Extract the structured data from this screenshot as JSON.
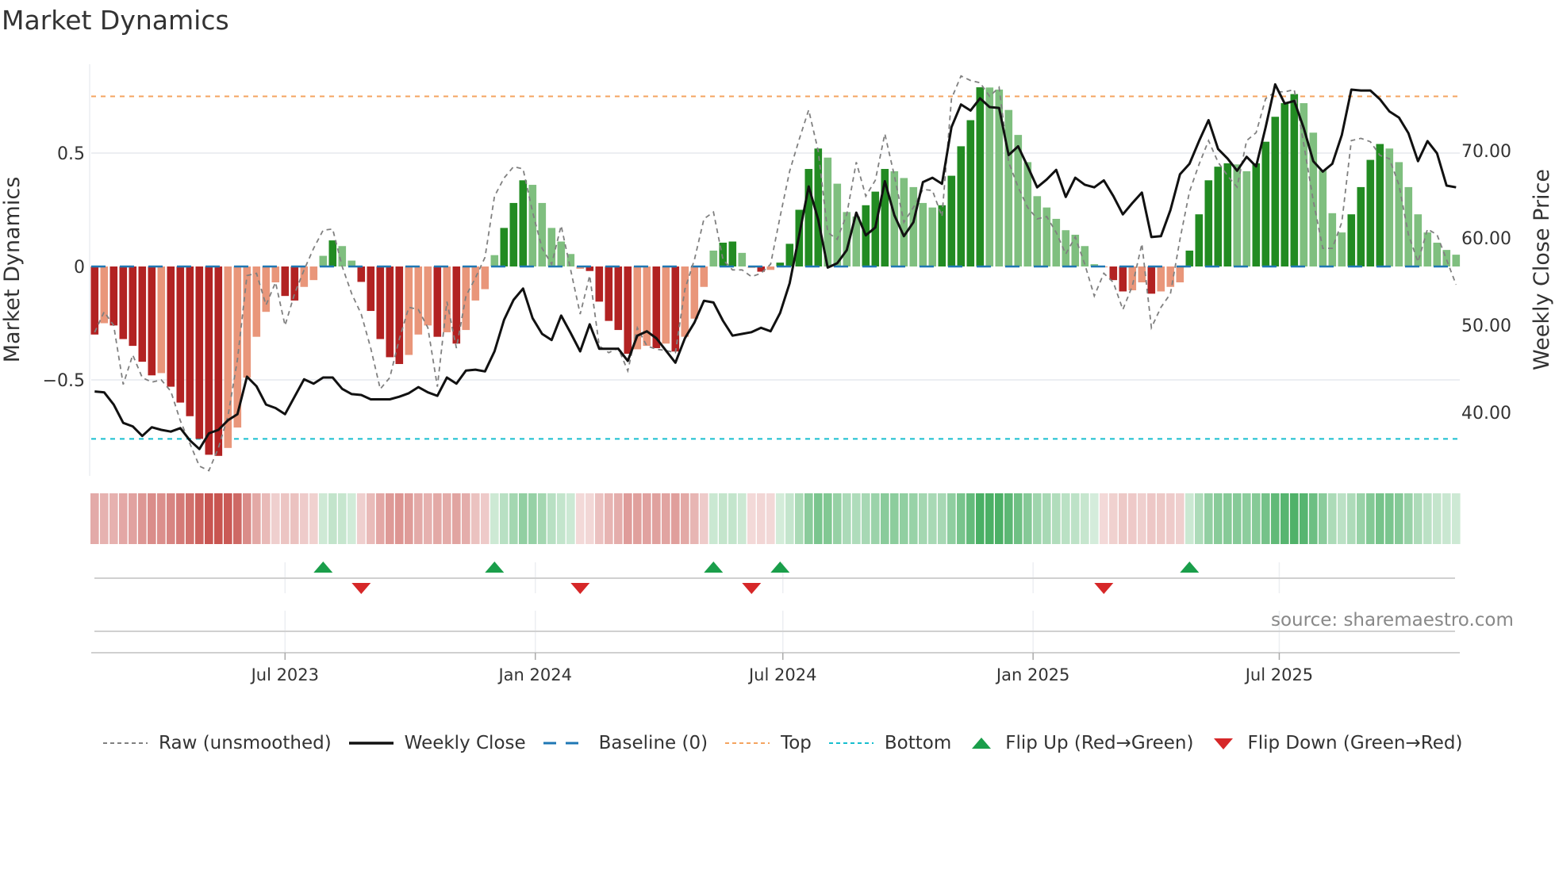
{
  "title": "Market Dynamics",
  "source": "source: sharemaestro.com",
  "colors": {
    "dark_red": "#b22222",
    "light_red": "#e9967a",
    "dark_green": "#228b22",
    "light_green": "#7fbf7f",
    "baseline": "#1f77b4",
    "top": "#f4a460",
    "bottom": "#17becf",
    "close": "#111111",
    "raw": "#808080",
    "flip_up": "#1a9e4a",
    "flip_down": "#d62728"
  },
  "legend": [
    {
      "key": "raw",
      "label": "Raw (unsmoothed)"
    },
    {
      "key": "close",
      "label": "Weekly Close"
    },
    {
      "key": "baseline",
      "label": "Baseline (0)"
    },
    {
      "key": "top",
      "label": "Top"
    },
    {
      "key": "bottom",
      "label": "Bottom"
    },
    {
      "key": "flip_up",
      "label": "Flip Up (Red→Green)"
    },
    {
      "key": "flip_down",
      "label": "Flip Down (Green→Red)"
    }
  ],
  "chart_data": {
    "type": "bar",
    "title": "Market Dynamics",
    "ylabel": "Market Dynamics",
    "y2label": "Weekly Close Price",
    "ylim": [
      -0.92,
      0.89
    ],
    "y2lim": [
      36.5,
      80.7
    ],
    "yticks": [
      {
        "v": 0.5,
        "label": "0.5"
      },
      {
        "v": 0,
        "label": "0"
      },
      {
        "v": -0.5,
        "label": "−0.5"
      }
    ],
    "y2ticks": [
      {
        "v": 70,
        "label": "70.00"
      },
      {
        "v": 60,
        "label": "60.00"
      },
      {
        "v": 50,
        "label": "50.00"
      },
      {
        "v": 40,
        "label": "40.00"
      }
    ],
    "start_date": "2023-02-11",
    "frequency": "weekly",
    "xticks": [
      {
        "date": "2023-07-01",
        "label": "Jul 2023"
      },
      {
        "date": "2024-01-01",
        "label": "Jan 2024"
      },
      {
        "date": "2024-07-01",
        "label": "Jul 2024"
      },
      {
        "date": "2025-01-01",
        "label": "Jan 2025"
      },
      {
        "date": "2025-07-01",
        "label": "Jul 2025"
      }
    ],
    "top": 0.75,
    "bottom": -0.76,
    "baseline": 0,
    "grid": true,
    "legend_position": "bottom",
    "hist": [
      -0.3,
      -0.25,
      -0.26,
      -0.32,
      -0.35,
      -0.42,
      -0.48,
      -0.47,
      -0.53,
      -0.6,
      -0.66,
      -0.76,
      -0.83,
      -0.835,
      -0.8,
      -0.71,
      -0.49,
      -0.31,
      -0.2,
      -0.07,
      -0.13,
      -0.15,
      -0.09,
      -0.06,
      0.047,
      0.115,
      0.09,
      0.026,
      -0.068,
      -0.196,
      -0.32,
      -0.4,
      -0.43,
      -0.39,
      -0.3,
      -0.26,
      -0.31,
      -0.29,
      -0.34,
      -0.28,
      -0.15,
      -0.1,
      0.05,
      0.17,
      0.28,
      0.38,
      0.36,
      0.28,
      0.17,
      0.11,
      0.055,
      -0.01,
      -0.02,
      -0.155,
      -0.24,
      -0.28,
      -0.385,
      -0.365,
      -0.35,
      -0.36,
      -0.34,
      -0.375,
      -0.31,
      -0.23,
      -0.09,
      0.07,
      0.105,
      0.11,
      0.06,
      -0.006,
      -0.023,
      -0.015,
      0.017,
      0.1,
      0.25,
      0.43,
      0.52,
      0.48,
      0.365,
      0.24,
      0.22,
      0.27,
      0.33,
      0.43,
      0.42,
      0.39,
      0.35,
      0.28,
      0.26,
      0.27,
      0.4,
      0.53,
      0.645,
      0.79,
      0.789,
      0.78,
      0.69,
      0.58,
      0.46,
      0.31,
      0.26,
      0.21,
      0.16,
      0.14,
      0.09,
      0.01,
      -0.003,
      -0.06,
      -0.11,
      -0.105,
      -0.07,
      -0.12,
      -0.11,
      -0.09,
      -0.07,
      0.07,
      0.23,
      0.38,
      0.44,
      0.455,
      0.45,
      0.42,
      0.455,
      0.55,
      0.66,
      0.72,
      0.76,
      0.72,
      0.59,
      0.425,
      0.235,
      0.15,
      0.23,
      0.35,
      0.47,
      0.54,
      0.52,
      0.46,
      0.35,
      0.23,
      0.15,
      0.105,
      0.073,
      0.052
    ],
    "raw": [
      -0.29,
      -0.2,
      -0.26,
      -0.52,
      -0.39,
      -0.49,
      -0.51,
      -0.5,
      -0.55,
      -0.68,
      -0.78,
      -0.88,
      -0.9,
      -0.8,
      -0.66,
      -0.41,
      -0.04,
      -0.03,
      -0.17,
      -0.07,
      -0.26,
      -0.12,
      -0.015,
      0.08,
      0.16,
      0.165,
      0.0,
      -0.12,
      -0.21,
      -0.36,
      -0.54,
      -0.49,
      -0.32,
      -0.18,
      -0.19,
      -0.27,
      -0.53,
      -0.155,
      -0.36,
      -0.13,
      -0.05,
      0.04,
      0.31,
      0.39,
      0.44,
      0.43,
      0.24,
      0.08,
      0.01,
      0.18,
      -0.015,
      -0.21,
      -0.04,
      -0.35,
      -0.38,
      -0.36,
      -0.46,
      -0.27,
      -0.35,
      -0.365,
      -0.37,
      -0.38,
      -0.1,
      0.03,
      0.21,
      0.24,
      0.03,
      -0.015,
      -0.015,
      -0.045,
      -0.03,
      0.01,
      0.22,
      0.42,
      0.56,
      0.69,
      0.51,
      0.15,
      0.12,
      0.23,
      0.46,
      0.31,
      0.38,
      0.585,
      0.4,
      0.195,
      0.26,
      0.34,
      0.335,
      0.22,
      0.74,
      0.84,
      0.82,
      0.81,
      0.75,
      0.79,
      0.46,
      0.35,
      0.26,
      0.21,
      0.22,
      0.15,
      0.055,
      0.13,
      0.01,
      -0.13,
      -0.03,
      -0.07,
      -0.19,
      -0.085,
      0.1,
      -0.27,
      -0.18,
      -0.12,
      0.12,
      0.33,
      0.45,
      0.555,
      0.46,
      0.4,
      0.35,
      0.555,
      0.59,
      0.74,
      0.77,
      0.77,
      0.78,
      0.54,
      0.29,
      0.08,
      0.08,
      0.195,
      0.555,
      0.565,
      0.55,
      0.49,
      0.475,
      0.36,
      0.14,
      0.02,
      0.165,
      0.14,
      0.03,
      -0.08
    ],
    "close": [
      42.4,
      42.3,
      40.9,
      38.8,
      38.4,
      37.3,
      38.3,
      38.0,
      37.8,
      38.2,
      36.8,
      35.8,
      37.6,
      38.0,
      39.1,
      39.8,
      44.1,
      43.0,
      40.9,
      40.5,
      39.8,
      41.8,
      43.8,
      43.3,
      44.0,
      44.0,
      42.7,
      42.1,
      42.0,
      41.5,
      41.5,
      41.5,
      41.8,
      42.2,
      42.9,
      42.3,
      41.9,
      44.0,
      43.3,
      44.8,
      44.9,
      44.7,
      47.0,
      50.6,
      52.9,
      54.2,
      50.8,
      49.0,
      48.3,
      51.1,
      49.1,
      47.0,
      50.1,
      47.3,
      47.3,
      47.3,
      45.9,
      48.8,
      49.3,
      48.5,
      47.1,
      45.7,
      48.5,
      50.3,
      52.8,
      52.6,
      50.5,
      48.8,
      49.0,
      49.2,
      49.7,
      49.3,
      51.4,
      54.8,
      60.3,
      65.9,
      62.1,
      56.6,
      57.1,
      58.6,
      62.9,
      60.3,
      61.2,
      66.5,
      62.6,
      60.2,
      61.8,
      66.4,
      66.9,
      66.2,
      72.7,
      75.3,
      74.6,
      76.0,
      75.0,
      74.9,
      69.5,
      70.5,
      68.2,
      65.8,
      66.7,
      67.8,
      64.7,
      66.9,
      66.1,
      65.8,
      66.6,
      64.8,
      62.7,
      64.0,
      65.2,
      60.1,
      60.2,
      63.2,
      67.3,
      68.5,
      71.1,
      73.5,
      70.2,
      69.1,
      67.7,
      69.3,
      68.2,
      72.7,
      77.6,
      75.4,
      75.7,
      72.6,
      68.8,
      67.6,
      68.5,
      71.8,
      77.0,
      76.9,
      76.9,
      75.9,
      74.5,
      73.8,
      72.0,
      68.8,
      71.1,
      69.7,
      66.0,
      65.8
    ]
  }
}
